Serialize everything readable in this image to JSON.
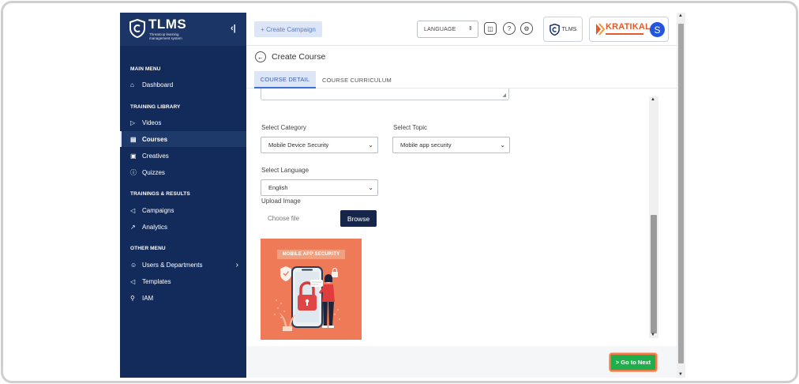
{
  "sidebar": {
    "brand_title": "TLMS",
    "brand_subtitle": "Threatcop learning management system",
    "sections": [
      {
        "heading": "MAIN MENU"
      },
      {
        "heading": "TRAINING LIBRARY"
      },
      {
        "heading": "TRAININGS & RESULTS"
      },
      {
        "heading": "OTHER MENU"
      }
    ],
    "items": [
      {
        "label": "Dashboard",
        "icon": "home-icon"
      },
      {
        "label": "Videos",
        "icon": "video-icon"
      },
      {
        "label": "Courses",
        "icon": "book-icon",
        "active": true
      },
      {
        "label": "Creatives",
        "icon": "image-icon"
      },
      {
        "label": "Quizzes",
        "icon": "question-icon"
      },
      {
        "label": "Campaigns",
        "icon": "megaphone-icon"
      },
      {
        "label": "Analytics",
        "icon": "chart-icon"
      },
      {
        "label": "Users & Departments",
        "icon": "user-icon"
      },
      {
        "label": "Templates",
        "icon": "megaphone-icon"
      },
      {
        "label": "IAM",
        "icon": "key-icon"
      }
    ]
  },
  "header": {
    "create_campaign": "+ Create Campaign",
    "language": "LANGUAGE",
    "tlms_badge": "TLMS",
    "org_logo_text": "KRATIKAL",
    "avatar_initial": "S"
  },
  "page": {
    "title": "Create Course",
    "tabs": [
      {
        "label": "COURSE DETAIL",
        "active": true
      },
      {
        "label": "COURSE CURRICULUM",
        "active": false
      }
    ]
  },
  "form": {
    "category_label": "Select Category",
    "category_value": "Mobile Device Security",
    "topic_label": "Select Topic",
    "topic_value": "Mobile app security",
    "language_label": "Select Language",
    "language_value": "English",
    "upload_label": "Upload Image",
    "file_placeholder": "Choose file",
    "browse_label": "Browse",
    "preview_title": "MOBILE APP SECURITY"
  },
  "footer": {
    "next_label": "> Go to Next"
  },
  "colors": {
    "sidebar": "#132b5a",
    "accent": "#3a6fd8",
    "next_button": "#1fae4b",
    "highlight": "#ef7a45",
    "preview_bg": "#ef7a57"
  }
}
